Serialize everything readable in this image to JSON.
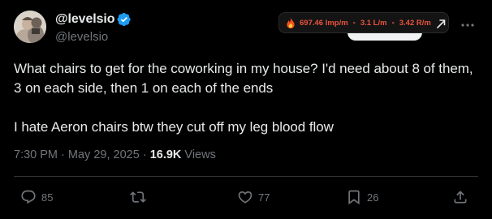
{
  "author": {
    "display_name": "@levelsio",
    "handle": "@levelsio",
    "verified": true,
    "verified_color": "#1d9bf0"
  },
  "stats_widget": {
    "icon": "fire-icon",
    "impressions_rate": "697.46 Imp/m",
    "likes_rate": "3.1 L/m",
    "reposts_rate": "3.42 R/m",
    "color": "#e8533d"
  },
  "tweet": {
    "paragraph_1": "What chairs to get for the coworking in my house? I'd need about 8 of them, 3 on each side, then 1 on each of the ends",
    "paragraph_2": "I hate Aeron chairs btw they cut off my leg blood flow"
  },
  "meta": {
    "time": "7:30 PM",
    "separator": "·",
    "date": "May 29, 2025",
    "views_count": "16.9K",
    "views_label": "Views"
  },
  "actions": {
    "reply_count": "85",
    "repost_count": "",
    "like_count": "77",
    "bookmark_count": "26"
  },
  "theme": {
    "background": "#000000",
    "text": "#e7e9ea",
    "secondary": "#71767b",
    "divider": "#2f3336"
  }
}
